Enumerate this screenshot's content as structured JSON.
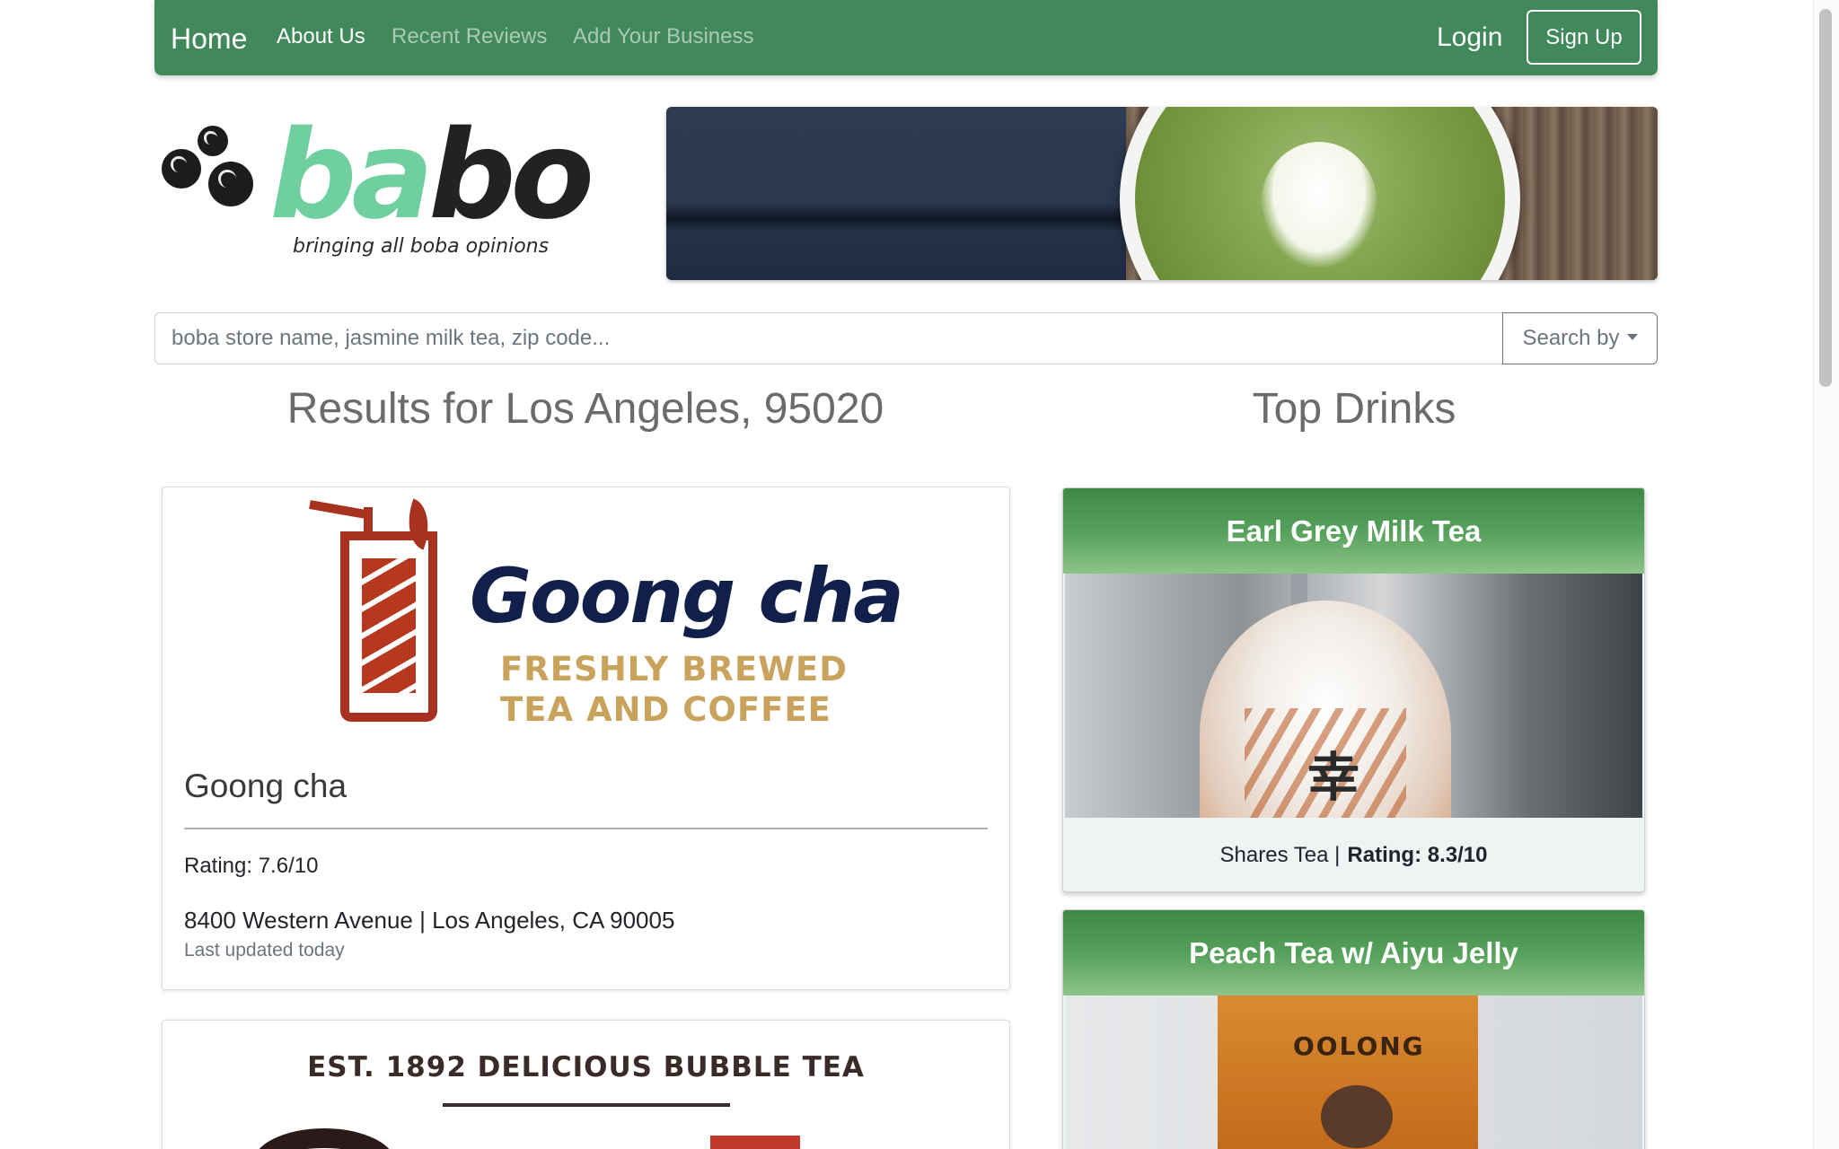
{
  "nav": {
    "brand": "Home",
    "links": [
      "About Us",
      "Recent Reviews",
      "Add Your Business"
    ],
    "login": "Login",
    "signup": "Sign Up"
  },
  "logo": {
    "word_part1": "ba",
    "word_part2": "bo",
    "tagline": "bringing all boba opinions"
  },
  "search": {
    "placeholder": "boba store name, jasmine milk tea, zip code...",
    "value": "",
    "search_by_label": "Search by"
  },
  "results": {
    "title": "Results for Los Angeles, 95020",
    "stores": [
      {
        "logo_name": "Goong cha",
        "logo_tagline_1": "FRESHLY BREWED",
        "logo_tagline_2": "TEA AND COFFEE",
        "name": "Goong cha",
        "rating": "Rating: 7.6/10",
        "address": "8400 Western Avenue | Los Angeles, CA 90005",
        "updated": "Last updated today"
      },
      {
        "logo_heading": "EST. 1892 DELICIOUS BUBBLE TEA"
      }
    ]
  },
  "top_drinks": {
    "title": "Top Drinks",
    "drinks": [
      {
        "name": "Earl Grey Milk Tea",
        "store": "Shares Tea |",
        "rating": "Rating: 8.3/10",
        "cup_text": "幸"
      },
      {
        "name": "Peach Tea w/ Aiyu Jelly",
        "cup_text": "OOLONG"
      }
    ]
  },
  "colors": {
    "navbar": "#41885a",
    "logo_accent": "#6fcf9e",
    "drink_header": "#3e8a45",
    "goongcha_red": "#a8321f",
    "goongcha_navy": "#10204a",
    "goongcha_gold": "#c9a35c"
  }
}
